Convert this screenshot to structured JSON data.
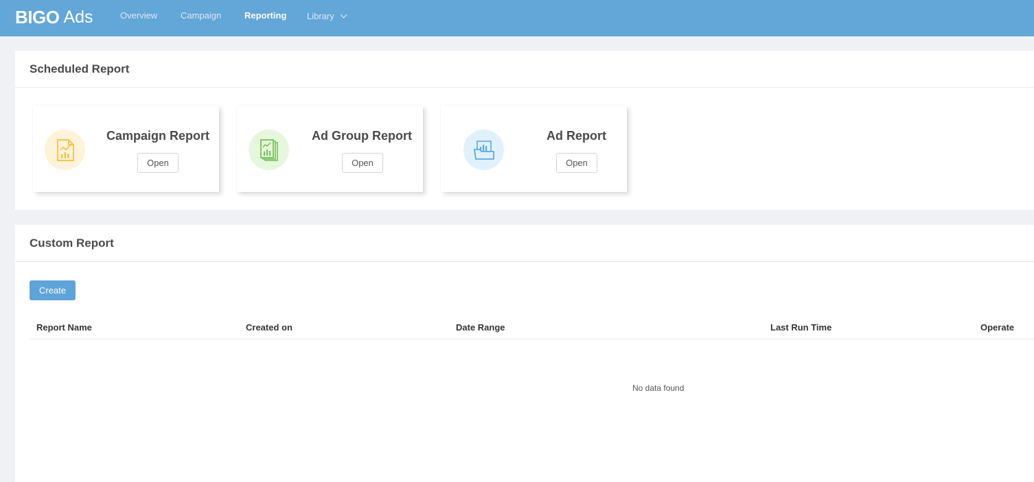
{
  "header": {
    "logo_bold": "BIGO",
    "logo_light": "Ads",
    "nav": [
      {
        "label": "Overview"
      },
      {
        "label": "Campaign"
      },
      {
        "label": "Reporting"
      },
      {
        "label": "Library"
      }
    ],
    "active_nav": "Reporting",
    "library_icon": "chevron-down-icon"
  },
  "scheduled": {
    "title": "Scheduled Report",
    "cards": [
      {
        "title": "Campaign Report",
        "button": "Open",
        "icon": "campaign-report-icon",
        "icon_color": "#f7c44b",
        "icon_bg": "#fdf3da"
      },
      {
        "title": "Ad Group Report",
        "button": "Open",
        "icon": "ad-group-report-icon",
        "icon_color": "#79c15a",
        "icon_bg": "#e6f7dd"
      },
      {
        "title": "Ad Report",
        "button": "Open",
        "icon": "ad-report-icon",
        "icon_color": "#5aaae3",
        "icon_bg": "#e0f1fc"
      }
    ]
  },
  "custom": {
    "title": "Custom Report",
    "create_label": "Create",
    "columns": [
      "Report Name",
      "Created on",
      "Date Range",
      "Last Run Time",
      "Operate"
    ],
    "empty_text": "No data found"
  },
  "colors": {
    "header_bg": "#63a6d8",
    "primary_button": "#5fa4d8",
    "page_bg": "#f0f1f5"
  }
}
